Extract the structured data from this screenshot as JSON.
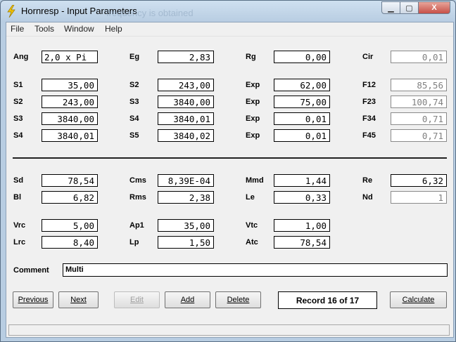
{
  "window": {
    "title": "Hornresp - Input Parameters",
    "ghost_title": "frequency is obtained",
    "controls": {
      "minimize": "▁",
      "maximize": "▢",
      "close": "X"
    }
  },
  "menu": [
    "File",
    "Tools",
    "Window",
    "Help"
  ],
  "horn": {
    "row0": [
      {
        "label": "Ang",
        "value": "2,0 x Pi"
      },
      {
        "label": "Eg",
        "value": "2,83"
      },
      {
        "label": "Rg",
        "value": "0,00"
      },
      {
        "label": "Cir",
        "value": "0,01"
      }
    ],
    "row1": [
      {
        "label": "S1",
        "value": "35,00"
      },
      {
        "label": "S2",
        "value": "243,00"
      },
      {
        "label": "Exp",
        "value": "62,00"
      },
      {
        "label": "F12",
        "value": "85,56"
      }
    ],
    "row2": [
      {
        "label": "S2",
        "value": "243,00"
      },
      {
        "label": "S3",
        "value": "3840,00"
      },
      {
        "label": "Exp",
        "value": "75,00"
      },
      {
        "label": "F23",
        "value": "100,74"
      }
    ],
    "row3": [
      {
        "label": "S3",
        "value": "3840,00"
      },
      {
        "label": "S4",
        "value": "3840,01"
      },
      {
        "label": "Exp",
        "value": "0,01"
      },
      {
        "label": "F34",
        "value": "0,71"
      }
    ],
    "row4": [
      {
        "label": "S4",
        "value": "3840,01"
      },
      {
        "label": "S5",
        "value": "3840,02"
      },
      {
        "label": "Exp",
        "value": "0,01"
      },
      {
        "label": "F45",
        "value": "0,71"
      }
    ]
  },
  "driver": {
    "row0": [
      {
        "label": "Sd",
        "value": "78,54"
      },
      {
        "label": "Cms",
        "value": "8,39E-04"
      },
      {
        "label": "Mmd",
        "value": "1,44"
      },
      {
        "label": "Re",
        "value": "6,32"
      }
    ],
    "row1": [
      {
        "label": "Bl",
        "value": "6,82"
      },
      {
        "label": "Rms",
        "value": "2,38"
      },
      {
        "label": "Le",
        "value": "0,33"
      },
      {
        "label": "Nd",
        "value": "1"
      }
    ]
  },
  "chamber": {
    "row0": [
      {
        "label": "Vrc",
        "value": "5,00"
      },
      {
        "label": "Ap1",
        "value": "35,00"
      },
      {
        "label": "Vtc",
        "value": "1,00"
      }
    ],
    "row1": [
      {
        "label": "Lrc",
        "value": "8,40"
      },
      {
        "label": "Lp",
        "value": "1,50"
      },
      {
        "label": "Atc",
        "value": "78,54"
      }
    ]
  },
  "comment": {
    "label": "Comment",
    "value": "Multi"
  },
  "buttons": {
    "previous": "Previous",
    "next": "Next",
    "edit": "Edit",
    "add": "Add",
    "delete": "Delete",
    "calculate": "Calculate"
  },
  "record": "Record 16 of 17",
  "colors": {
    "accent_title": "#b9cfe2",
    "close_button": "#c75048"
  }
}
